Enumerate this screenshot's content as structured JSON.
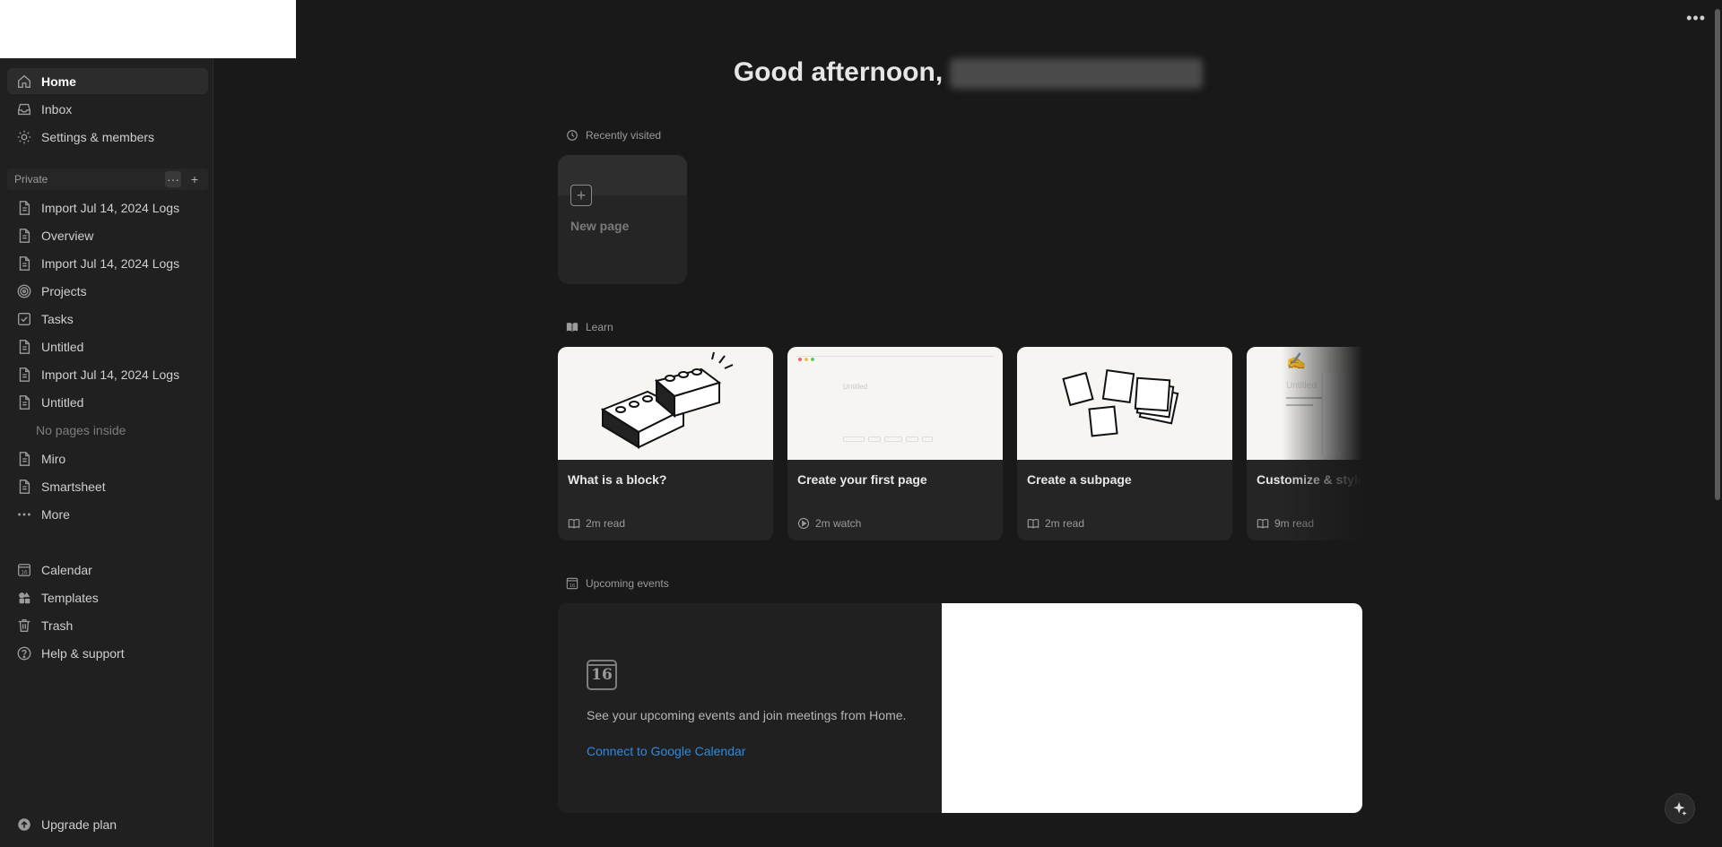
{
  "sidebar": {
    "top_nav": [
      {
        "label": "Home",
        "icon": "home-icon"
      },
      {
        "label": "Inbox",
        "icon": "inbox-icon"
      },
      {
        "label": "Settings & members",
        "icon": "gear-icon"
      }
    ],
    "section_title": "Private",
    "pages": [
      {
        "label": "Import Jul 14, 2024 Logs",
        "icon": "page-icon"
      },
      {
        "label": "Overview",
        "icon": "page-icon"
      },
      {
        "label": "Import Jul 14, 2024 Logs",
        "icon": "page-icon"
      },
      {
        "label": "Projects",
        "icon": "target-icon"
      },
      {
        "label": "Tasks",
        "icon": "checkbox-icon"
      },
      {
        "label": "Untitled",
        "icon": "page-icon"
      },
      {
        "label": "Import Jul 14, 2024 Logs",
        "icon": "page-icon"
      },
      {
        "label": "Untitled",
        "icon": "page-icon"
      }
    ],
    "no_pages_text": "No pages inside",
    "pages_after": [
      {
        "label": "Miro",
        "icon": "page-icon"
      },
      {
        "label": "Smartsheet",
        "icon": "page-icon"
      },
      {
        "label": "More",
        "icon": "ellipsis-icon"
      }
    ],
    "bottom_nav": [
      {
        "label": "Calendar",
        "icon": "calendar-icon"
      },
      {
        "label": "Templates",
        "icon": "shapes-icon"
      },
      {
        "label": "Trash",
        "icon": "trash-icon"
      },
      {
        "label": "Help & support",
        "icon": "help-icon"
      }
    ],
    "upgrade_label": "Upgrade plan"
  },
  "main": {
    "greeting": "Good afternoon,",
    "recently_visited": {
      "label": "Recently visited",
      "new_page_label": "New page"
    },
    "learn": {
      "label": "Learn",
      "cards": [
        {
          "title": "What is a block?",
          "meta": "2m read",
          "meta_icon": "book-icon"
        },
        {
          "title": "Create your first page",
          "meta": "2m watch",
          "meta_icon": "play-icon",
          "thumb_text": "Untitled"
        },
        {
          "title": "Create a subpage",
          "meta": "2m read",
          "meta_icon": "book-icon"
        },
        {
          "title": "Customize & style content",
          "meta": "9m read",
          "meta_icon": "book-icon",
          "thumb_text": "Untitled"
        }
      ]
    },
    "upcoming_events": {
      "label": "Upcoming events",
      "calendar_day": "16",
      "description": "See your upcoming events and join meetings from Home.",
      "connect_link": "Connect to Google Calendar"
    }
  },
  "colors": {
    "background": "#191919",
    "sidebar": "#202020",
    "link": "#2f8ae0"
  }
}
